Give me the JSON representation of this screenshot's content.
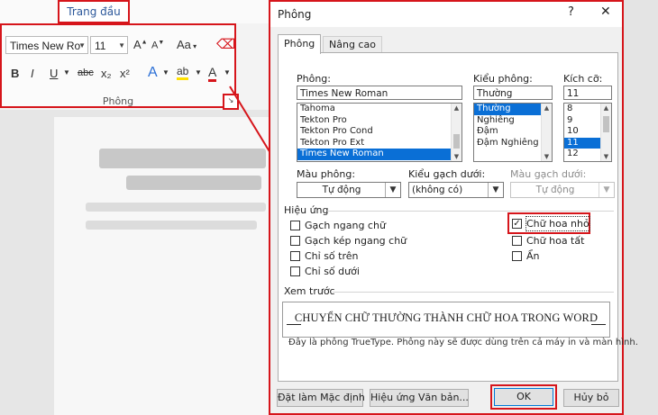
{
  "ribbon": {
    "home_tab": "Trang đầu",
    "font_name": "Times New Ro",
    "font_size": "11",
    "grow_icon": "A▲",
    "shrink_icon": "A▼",
    "case_label": "Aa",
    "bold": "B",
    "italic": "I",
    "underline": "U",
    "strike": "abc",
    "subscript": "x₂",
    "superscript": "x²",
    "group_label": "Phông"
  },
  "dialog": {
    "title": "Phông",
    "help": "?",
    "close": "✕",
    "tabs": [
      "Phông",
      "Nâng cao"
    ],
    "font": {
      "label": "Phông:",
      "value": "Times New Roman",
      "list": [
        "Tahoma",
        "Tekton Pro",
        "Tekton Pro Cond",
        "Tekton Pro Ext",
        "Times New Roman"
      ],
      "selected": "Times New Roman"
    },
    "style": {
      "label": "Kiểu phông:",
      "value": "Thường",
      "list": [
        "Thường",
        "Nghiêng",
        "Đậm",
        "Đậm Nghiêng"
      ],
      "selected": "Thường"
    },
    "size": {
      "label": "Kích cỡ:",
      "value": "11",
      "list": [
        "8",
        "9",
        "10",
        "11",
        "12"
      ],
      "selected": "11"
    },
    "font_color": {
      "label": "Màu phông:",
      "value": "Tự động"
    },
    "underline_style": {
      "label": "Kiểu gạch dưới:",
      "value": "(không có)"
    },
    "underline_color": {
      "label": "Màu gạch dưới:",
      "value": "Tự động"
    },
    "effects": {
      "label": "Hiệu ứng",
      "left": [
        {
          "label": "Gạch ngang chữ",
          "checked": false
        },
        {
          "label": "Gạch kép ngang chữ",
          "checked": false
        },
        {
          "label": "Chỉ số trên",
          "checked": false
        },
        {
          "label": "Chỉ số dưới",
          "checked": false
        }
      ],
      "right": [
        {
          "label": "Chữ hoa nhỏ",
          "checked": true
        },
        {
          "label": "Chữ hoa tất",
          "checked": false
        },
        {
          "label": "Ẩn",
          "checked": false
        }
      ]
    },
    "preview": {
      "label": "Xem trước",
      "text": "CHUYỂN CHỮ THƯỜNG THÀNH CHỮ HOA TRONG WORD",
      "note": "Đây là phông TrueType. Phông này sẽ được dùng trên cả máy in và màn hình."
    },
    "buttons": {
      "set_default": "Đặt làm Mặc định",
      "text_effects": "Hiệu ứng Văn bản...",
      "ok": "OK",
      "cancel": "Hủy bỏ"
    }
  },
  "colors": {
    "highlight": "#d6151b",
    "selection": "#0a6fd6",
    "accent": "#2b579a"
  },
  "icons": [
    "grow-font-icon",
    "shrink-font-icon",
    "clear-formatting-icon",
    "text-effects-icon",
    "highlight-icon",
    "font-color-icon",
    "dialog-launcher-icon",
    "check-icon"
  ]
}
